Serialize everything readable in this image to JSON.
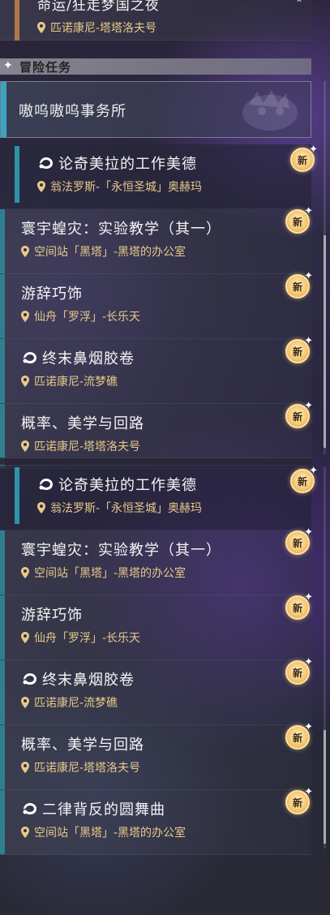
{
  "top_partial": {
    "title": "命运/狂走梦国之夜",
    "location": "匹诺康尼-塔塔洛夫号"
  },
  "section": {
    "label": "冒险任务"
  },
  "category": {
    "label": "嗷呜嗷呜事务所"
  },
  "new_label": "新",
  "upper_list": [
    {
      "title": "论奇美拉的工作美德",
      "location": "翁法罗斯-「永恒圣城」奥赫玛",
      "has_icon": true
    },
    {
      "title": "寰宇蝗灾：实验教学（其一）",
      "location": "空间站「黑塔」-黑塔的办公室",
      "has_icon": false
    },
    {
      "title": "游辞巧饰",
      "location": "仙舟「罗浮」-长乐天",
      "has_icon": false
    },
    {
      "title": "终末鼻烟胶卷",
      "location": "匹诺康尼-流梦礁",
      "has_icon": true
    },
    {
      "title": "概率、美学与回路",
      "location": "匹诺康尼-塔塔洛夫号",
      "has_icon": false
    }
  ],
  "lower_list": [
    {
      "title": "论奇美拉的工作美德",
      "location": "翁法罗斯-「永恒圣城」奥赫玛",
      "has_icon": true
    },
    {
      "title": "寰宇蝗灾：实验教学（其一）",
      "location": "空间站「黑塔」-黑塔的办公室",
      "has_icon": false
    },
    {
      "title": "游辞巧饰",
      "location": "仙舟「罗浮」-长乐天",
      "has_icon": false
    },
    {
      "title": "终末鼻烟胶卷",
      "location": "匹诺康尼-流梦礁",
      "has_icon": true
    },
    {
      "title": "概率、美学与回路",
      "location": "匹诺康尼-塔塔洛夫号",
      "has_icon": false
    },
    {
      "title": "二律背反的圆舞曲",
      "location": "空间站「黑塔」-黑塔的办公室",
      "has_icon": true
    }
  ],
  "colors": {
    "accent_bar": "#2f7f8f",
    "location_text": "#e9c98a",
    "badge": "#f5c978"
  },
  "icons": [
    "pin-icon",
    "chimera-icon",
    "new-badge",
    "diamond-icon"
  ]
}
